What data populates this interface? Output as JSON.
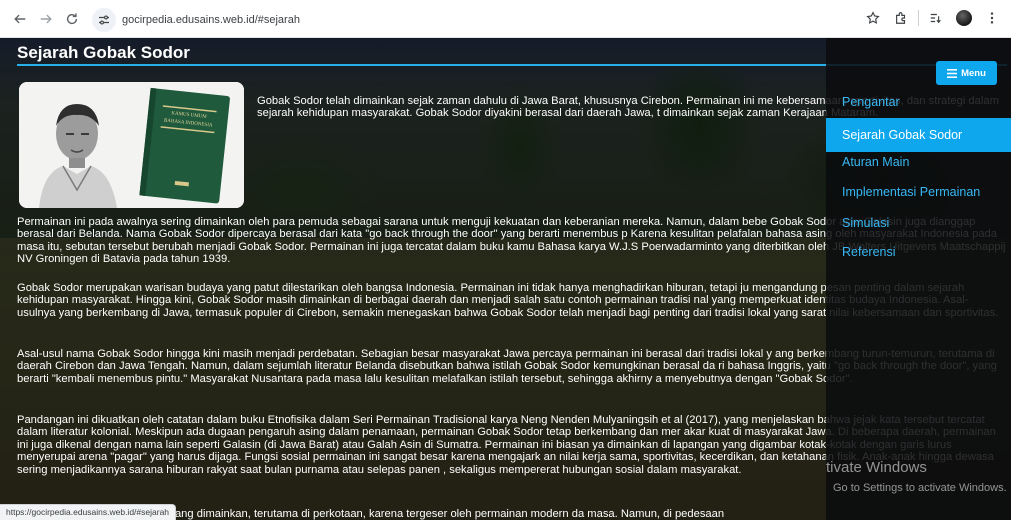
{
  "browser": {
    "url": "gocirpedia.edusains.web.id/#sejarah",
    "status_url": "https://gocirpedia.edusains.web.id/#sejarah",
    "icons": [
      "back-arrow-icon",
      "forward-arrow-icon",
      "reload-icon",
      "site-info-icon",
      "bookmark-star-icon",
      "extensions-icon",
      "reading-list-icon",
      "profile-avatar-icon",
      "more-vert-icon"
    ]
  },
  "article": {
    "title": "Sejarah Gobak Sodor",
    "book_cover_text": "KAMUS UMUM BAHASA INDONESIA",
    "intro": "Gobak Sodor telah dimainkan sejak zaman dahulu di Jawa Barat, khususnya Cirebon. Permainan ini me                                    kebersamaan, sportivitas, dan strategi dalam sejarah kehidupan masyarakat. Gobak Sodor diyakini berasal dari daerah Jawa, t                  dimainkan sejak zaman Kerajaan Mataram.",
    "paragraphs": [
      "Permainan ini pada awalnya sering dimainkan oleh para pemuda sebagai sarana untuk menguji kekuatan dan keberanian mereka. Namun, dalam bebe                  Gobak Sodor atau Galasin juga dianggap berasal dari Belanda. Nama Gobak Sodor dipercaya berasal dari kata \"go back through the door\" yang berarti menembus p                 Karena kesulitan pelafalan bahasa asing oleh masyarakat Indonesia pada masa itu, sebutan tersebut berubah menjadi Gobak Sodor. Permainan ini juga tercatat dalam buku kamu                 Bahasa karya W.J.S Poerwadarminto yang diterbitkan oleh JB Wolters Uitgevers Maatschappij NV Groningen di Batavia pada tahun 1939.",
      "Gobak Sodor merupakan warisan budaya yang patut dilestarikan oleh bangsa Indonesia. Permainan ini tidak hanya menghadirkan hiburan, tetapi ju                  mengandung pesan penting dalam sejarah kehidupan masyarakat. Hingga kini, Gobak Sodor masih dimainkan di berbagai daerah dan menjadi salah satu contoh permainan tradisi                  nal yang memperkuat identitas budaya Indonesia. Asal-usulnya yang berkembang di Jawa, termasuk populer di Cirebon, semakin menegaskan bahwa Gobak Sodor telah menjadi bagi                  penting dari tradisi lokal yang sarat nilai kebersamaan dan sportivitas.",
      "Asal-usul nama Gobak Sodor hingga kini masih menjadi perdebatan. Sebagian besar masyarakat Jawa percaya permainan ini berasal dari tradisi lokal y                 ang berkembang turun-temurun, terutama di daerah Cirebon dan Jawa Tengah. Namun, dalam sejumlah literatur Belanda disebutkan bahwa istilah Gobak Sodor kemungkinan berasal da                 ri bahasa Inggris, yaitu \"go back through the door\", yang berarti \"kembali menembus pintu.\" Masyarakat Nusantara pada masa lalu kesulitan melafalkan istilah tersebut, sehingga akhirny                 a menyebutnya dengan \"Gobak Sodor\".",
      "Pandangan ini dikuatkan oleh catatan dalam buku Etnofisika dalam Seri Permainan Tradisional karya Neng Nenden Mulyaningsih et al (2017), yang                  menjelaskan bahwa jejak kata tersebut tercatat dalam literatur kolonial. Meskipun ada dugaan pengaruh asing dalam penamaan, permainan Gobak Sodor tetap berkembang dan mer                  akar kuat di masyarakat Jawa. Di beberapa daerah, permainan ini juga dikenal dengan nama lain seperti Galasin (di Jawa Barat) atau Galah Asin di Sumatra. Permainan ini biasan                  ya dimainkan di lapangan yang digambar kotak-kotak dengan garis lurus menyerupai arena \"pagar\" yang harus dijaga. Fungsi sosial permainan ini sangat besar karena mengajark                  an nilai kerja sama, sportivitas, kecerdikan, dan ketahanan fisik. Anak-anak hingga dewasa sering menjadikannya sarana hiburan rakyat saat bulan purnama atau selepas panen                  , sekaligus mempererat hubungan sosial dalam masyarakat.",
      "Gobak Sodor perlahan mulai jarang dimainkan, terutama di perkotaan, karena tergeser oleh permainan modern da                  masa. Namun, di pedesaan"
    ]
  },
  "menu": {
    "button_label": "Menu",
    "items": [
      {
        "label": "Pengantar",
        "active": false
      },
      {
        "label": "Sejarah Gobak Sodor",
        "active": true
      },
      {
        "label": "Aturan Main",
        "active": false
      },
      {
        "label": "Implementasi Permainan",
        "active": false
      },
      {
        "label": "Simulasi",
        "active": false
      },
      {
        "label": "Referensi",
        "active": false
      }
    ]
  },
  "watermark": {
    "title": "tivate Windows",
    "subtitle": "Go to Settings to activate Windows."
  },
  "colors": {
    "accent": "#0ea7ee",
    "menu_link": "#38b8f4",
    "title_rule": "#29b0e8"
  }
}
